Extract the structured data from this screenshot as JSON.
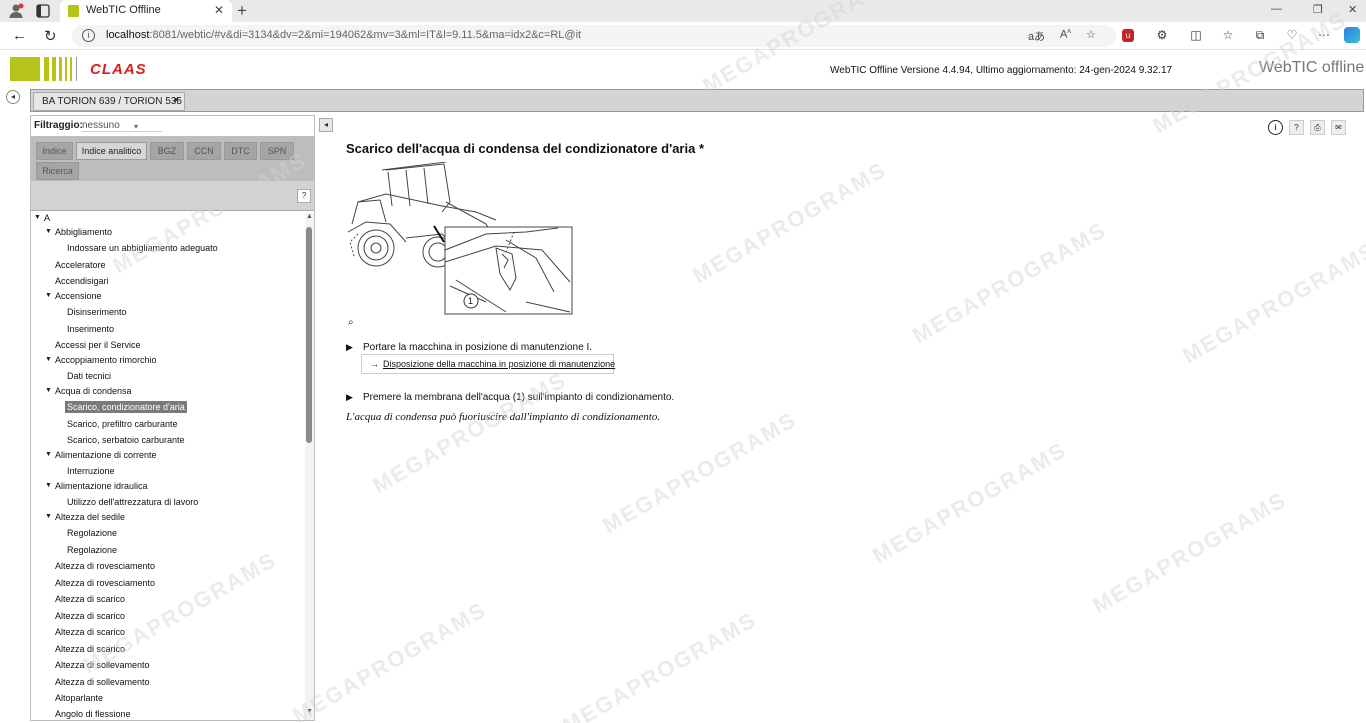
{
  "browser": {
    "tab_title": "WebTIC Offline",
    "url_host": "localhost",
    "url_rest": ":8081/webtic/#v&di=3134&dv=2&mi=194062&mv=3&ml=IT&l=9.11.5&ma=idx2&c=RL@it"
  },
  "header": {
    "logo_text": "CLAAS",
    "version_text": "WebTIC Offline Versione 4.4.94, Ultimo aggiornamento: 24-gen-2024 9.32.17",
    "brand": "WebTIC offline"
  },
  "doc_tab": {
    "label": "BA TORION 639 / TORION 535"
  },
  "filter": {
    "label": "Filtraggio:",
    "value": "nessuno"
  },
  "nav_tabs": [
    {
      "label": "Indice"
    },
    {
      "label": "Indice analitico"
    },
    {
      "label": "BGZ"
    },
    {
      "label": "CCN"
    },
    {
      "label": "DTC"
    },
    {
      "label": "SPN"
    },
    {
      "label": "Ricerca"
    }
  ],
  "tree": [
    {
      "label": "A"
    },
    {
      "label": "Abbigliamento"
    },
    {
      "label": "Indossare un abbigliamento adeguato"
    },
    {
      "label": "Acceleratore"
    },
    {
      "label": "Accendisigari"
    },
    {
      "label": "Accensione"
    },
    {
      "label": "Disinserimento"
    },
    {
      "label": "Inserimento"
    },
    {
      "label": "Accessi per il Service"
    },
    {
      "label": "Accoppiamento rimorchio"
    },
    {
      "label": "Dati tecnici"
    },
    {
      "label": "Acqua di condensa"
    },
    {
      "label": "Scarico, condizionatore d'aria"
    },
    {
      "label": "Scarico, prefiltro carburante"
    },
    {
      "label": "Scarico, serbatoio carburante"
    },
    {
      "label": "Alimentazione di corrente"
    },
    {
      "label": "Interruzione"
    },
    {
      "label": "Alimentazione idraulica"
    },
    {
      "label": "Utilizzo dell'attrezzatura di lavoro"
    },
    {
      "label": "Altezza del sedile"
    },
    {
      "label": "Regolazione"
    },
    {
      "label": "Regolazione"
    },
    {
      "label": "Altezza di rovesciamento"
    },
    {
      "label": "Altezza di rovesciamento"
    },
    {
      "label": "Altezza di scarico"
    },
    {
      "label": "Altezza di scarico"
    },
    {
      "label": "Altezza di scarico"
    },
    {
      "label": "Altezza di scarico"
    },
    {
      "label": "Altezza di sollevamento"
    },
    {
      "label": "Altezza di sollevamento"
    },
    {
      "label": "Altoparlante"
    },
    {
      "label": "Angolo di flessione"
    }
  ],
  "content": {
    "title": "Scarico dell'acqua di condensa del condizionatore d'aria *",
    "figure_callout": "1",
    "step1": "Portare la macchina in posizione di manutenzione I.",
    "step1_link": "Disposizione della macchina in posizione di manutenzione",
    "step2": "Premere la membrana dell'acqua (1) sull'impianto di condizionamento.",
    "note": "L'acqua di condensa può fuoriuscire dall'impianto di condizionamento."
  },
  "watermark": "MEGAPROGRAMS",
  "colors": {
    "brand_green": "#b8c31a",
    "brand_red": "#d8201c"
  }
}
